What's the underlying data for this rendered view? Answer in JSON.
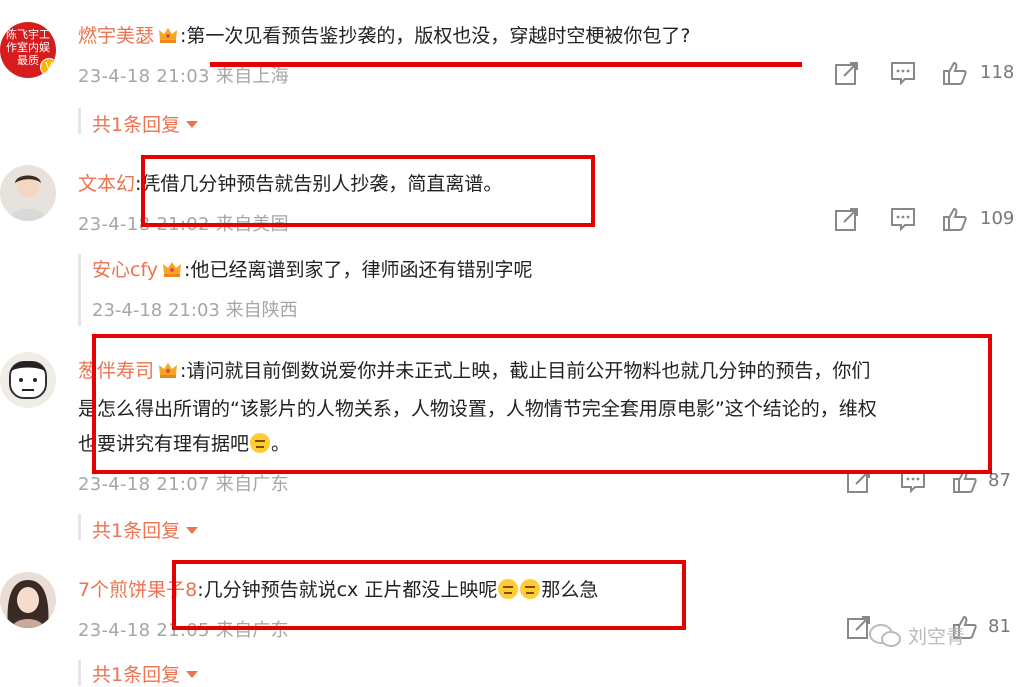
{
  "comments": [
    {
      "avatar_text": [
        "陈飞宇工",
        "作室内娱",
        "最质"
      ],
      "username": "燃宇美瑟",
      "text": ":第一次见看预告鉴抄袭的，版权也没，穿越时空梗被你包了?",
      "meta": "23-4-18 21:03 来自上海",
      "likes": "118",
      "replies": "共1条回复"
    },
    {
      "username": "文本幻",
      "text": ":凭借几分钟预告就告别人抄袭，简直离谱。",
      "meta": "23-4-18 21:02 来自美国",
      "likes": "109",
      "sub_reply": {
        "username": "安心cfy",
        "text": ":他已经离谱到家了，律师函还有错别字呢",
        "meta": "23-4-18 21:03 来自陕西"
      }
    },
    {
      "username": "葱伴寿司",
      "text_lines": [
        ":请问就目前倒数说爱你并未正式上映，截止目前公开物料也就几分钟的预告，你们",
        "是怎么得出所谓的“该影片的人物关系，人物设置，人物情节完全套用原电影”这个结论的，维权",
        "也要讲究有理有据吧"
      ],
      "text_end": "。",
      "meta": "23-4-18 21:07 来自广东",
      "likes": "87",
      "replies": "共1条回复"
    },
    {
      "username": "7个煎饼果子8",
      "text": ":几分钟预告就说cx 正片都没上映呢",
      "text_end": "那么急",
      "meta": "23-4-18 21:05 来自广东",
      "likes": "81",
      "replies": "共1条回复"
    }
  ],
  "watermark": "刘空青",
  "colors": {
    "username": "#eb7350",
    "highlight": "#e60000",
    "meta": "#a6a6a6"
  },
  "icons": [
    "share-icon",
    "comment-icon",
    "like-icon",
    "crown-icon",
    "verified-icon"
  ]
}
